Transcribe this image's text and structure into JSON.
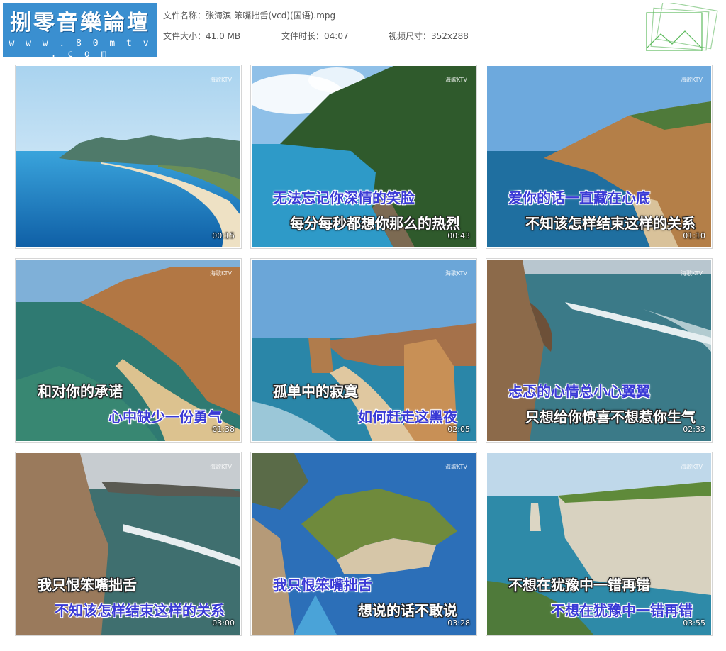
{
  "header": {
    "logo_main": "捌零音樂論壇",
    "logo_url": "w w w . 8 0 m t v . c o m",
    "file_name_label": "文件名称：",
    "file_name": "张海滨-笨嘴拙舌(vcd)(国语).mpg",
    "file_size_label": "文件大小：",
    "file_size": "41.0 MB",
    "duration_label": "文件时长：",
    "duration": "04:07",
    "video_size_label": "视频尺寸：",
    "video_size": "352x288"
  },
  "watermark": "海歌KTV",
  "thumbnails": [
    {
      "time": "00:15",
      "lyric1": "",
      "lyric2": ""
    },
    {
      "time": "00:43",
      "lyric1": "无法忘记你深情的笑脸",
      "lyric2": "每分每秒都想你那么的热烈"
    },
    {
      "time": "01:10",
      "lyric1": "爱你的话一直藏在心底",
      "lyric2": "不知该怎样结束这样的关系"
    },
    {
      "time": "01:38",
      "lyric1": "和对你的承诺",
      "lyric2": "心中缺少一份勇气"
    },
    {
      "time": "02:05",
      "lyric1": "孤单中的寂寞",
      "lyric2": "如何赶走这黑夜"
    },
    {
      "time": "02:33",
      "lyric1": "忐忑的心情总小心翼翼",
      "lyric2": "只想给你惊喜不想惹你生气"
    },
    {
      "time": "03:00",
      "lyric1": "我只恨笨嘴拙舌",
      "lyric2": "不知该怎样结束这样的关系"
    },
    {
      "time": "03:28",
      "lyric1": "我只恨笨嘴拙舌",
      "lyric2": "想说的话不敢说"
    },
    {
      "time": "03:55",
      "lyric1": "不想在犹豫中一错再错",
      "lyric2": "不想在犹豫中一错再错"
    }
  ]
}
